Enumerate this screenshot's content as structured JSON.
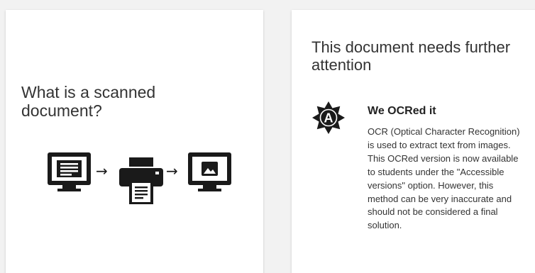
{
  "left_card": {
    "title": "What is a scanned document?",
    "diagram": {
      "steps": [
        "monitor-document-icon",
        "printer-icon",
        "monitor-image-icon"
      ],
      "arrow_glyph": "→"
    }
  },
  "right_card": {
    "title": "This document needs further attention",
    "badge": {
      "icon": "accessibility-badge-icon",
      "letter": "A"
    },
    "notice": {
      "heading": "We OCRed it",
      "body": "OCR (Optical Character Recognition) is used to extract text from images. This OCRed version is now available to students under the \"Accessible versions\" option. However, this method can be very inaccurate and should not be considered a final solution."
    }
  },
  "colors": {
    "background": "#f2f2f2",
    "card": "#ffffff",
    "ink": "#1a1a1a"
  }
}
